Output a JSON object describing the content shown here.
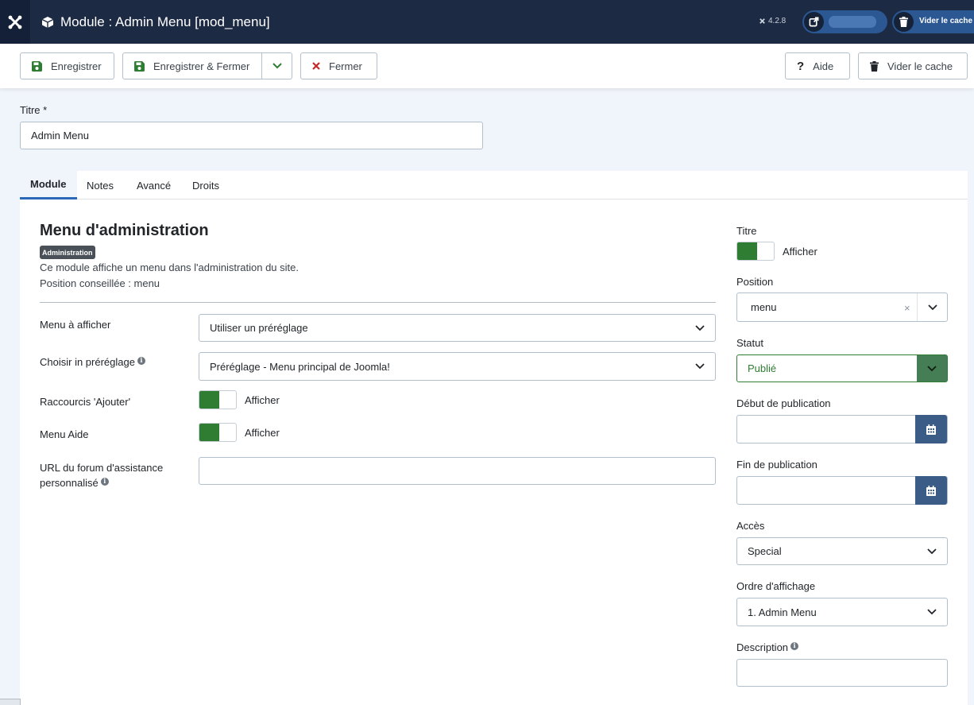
{
  "header": {
    "title": "Module : Admin Menu [mod_menu]",
    "version": "4.2.8",
    "cache_label": "Vider le cache"
  },
  "toolbar": {
    "save": "Enregistrer",
    "save_close": "Enregistrer & Fermer",
    "close": "Fermer",
    "help": "Aide",
    "clear_cache": "Vider le cache"
  },
  "title_field": {
    "label": "Titre *",
    "value": "Admin Menu"
  },
  "tabs": [
    "Module",
    "Notes",
    "Avancé",
    "Droits"
  ],
  "module": {
    "heading": "Menu d'administration",
    "badge": "Administration",
    "description": "Ce module affiche un menu dans l'administration du site.",
    "position_hint": "Position conseillée : menu"
  },
  "fields": {
    "menu_label": "Menu à afficher",
    "menu_value": "Utiliser un préréglage",
    "preset_label": "Choisir in préréglage",
    "preset_value": "Préréglage - Menu principal de Joomla!",
    "shortcuts_label": "Raccourcis 'Ajouter'",
    "shortcuts_value": "Afficher",
    "help_menu_label": "Menu Aide",
    "help_menu_value": "Afficher",
    "forum_label_1": "URL du forum d'assistance",
    "forum_label_2": "personnalisé",
    "forum_value": ""
  },
  "sidebar": {
    "title_label": "Titre",
    "title_value": "Afficher",
    "position_label": "Position",
    "position_value": "menu",
    "status_label": "Statut",
    "status_value": "Publié",
    "publish_up_label": "Début de publication",
    "publish_down_label": "Fin de publication",
    "access_label": "Accès",
    "access_value": "Special",
    "order_label": "Ordre d'affichage",
    "order_value": "1. Admin Menu",
    "description_label": "Description",
    "clear_symbol": "×"
  },
  "colors": {
    "header": "#1c2a43",
    "accent": "#2a69b8",
    "success": "#2f7d32",
    "date_button": "#3c5c88"
  }
}
